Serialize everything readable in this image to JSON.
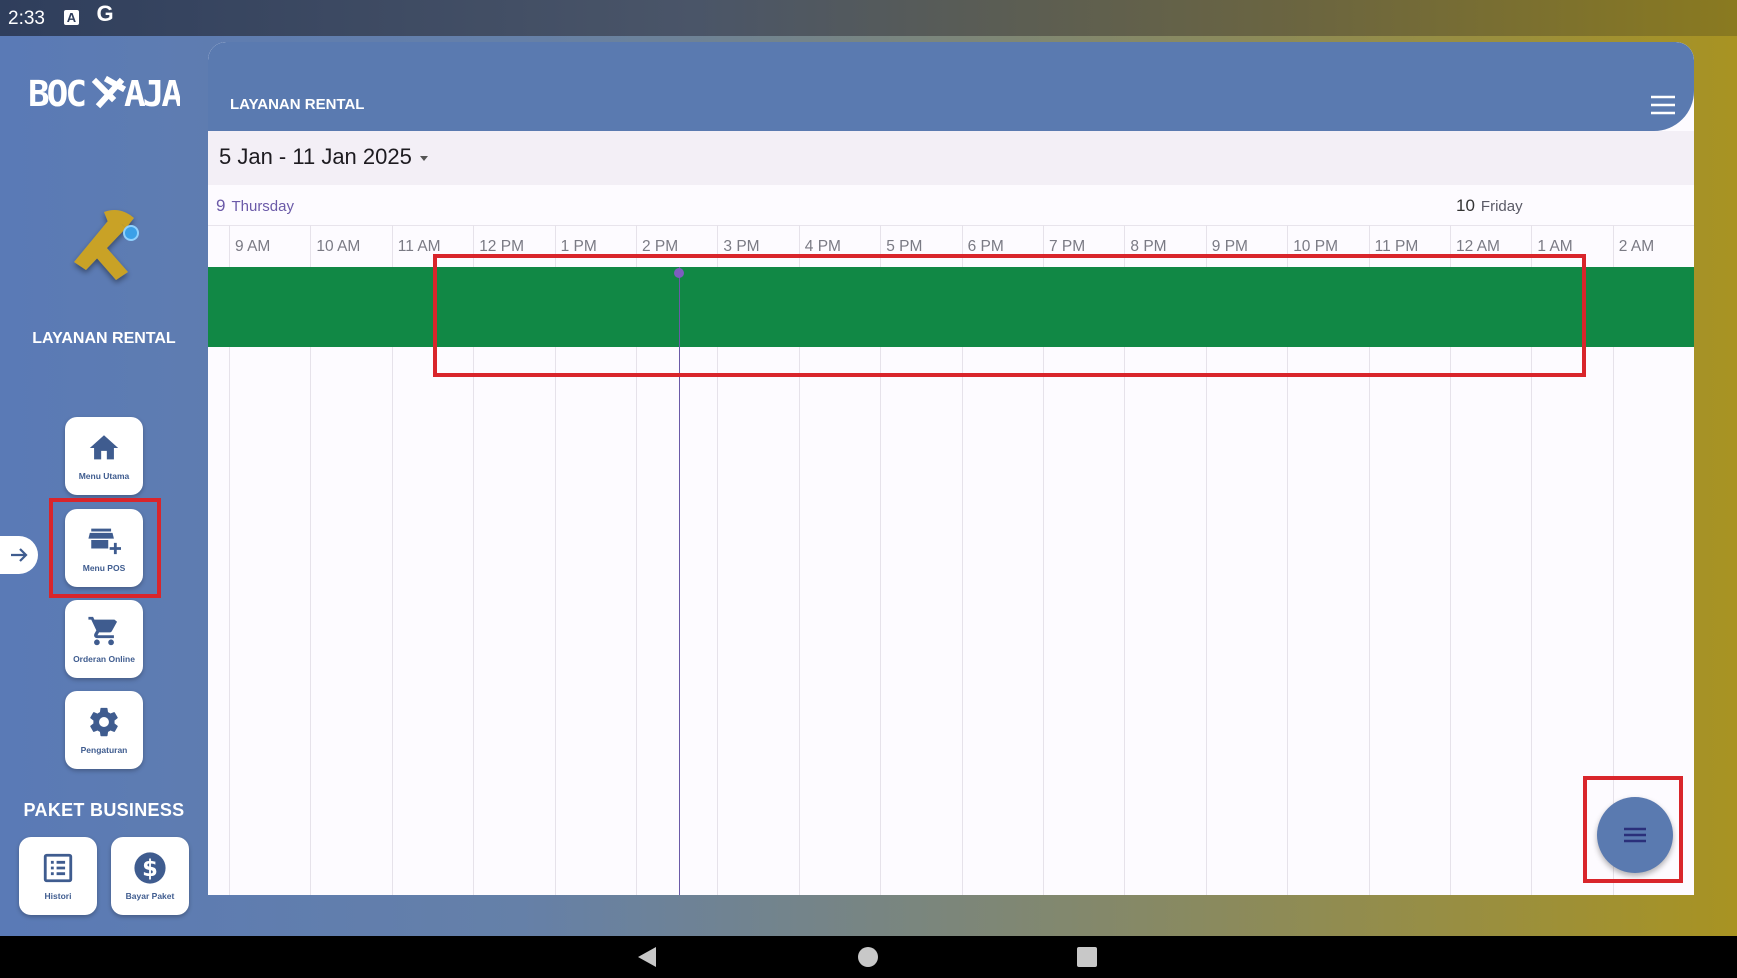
{
  "status_bar": {
    "time": "2:33",
    "icon_a": "A",
    "icon_g": "G"
  },
  "brand": {
    "logo_text": "BOC⛏AJA",
    "accent": "#5a7ab0"
  },
  "sidebar": {
    "title": "LAYANAN RENTAL",
    "tiles": [
      {
        "label": "Menu Utama",
        "icon": "home-icon"
      },
      {
        "label": "Menu POS",
        "icon": "store-add-icon"
      },
      {
        "label": "Orderan Online",
        "icon": "cart-icon"
      },
      {
        "label": "Pengaturan",
        "icon": "gear-icon"
      }
    ],
    "section_title": "PAKET BUSINESS",
    "paket_tiles": [
      {
        "label": "Histori",
        "icon": "list-icon"
      },
      {
        "label": "Bayar Paket",
        "icon": "dollar-icon"
      }
    ]
  },
  "header": {
    "title": "LAYANAN RENTAL"
  },
  "calendar": {
    "range_label": "5 Jan - 11 Jan 2025",
    "days": [
      {
        "num": "9",
        "name": "Thursday"
      },
      {
        "num": "10",
        "name": "Friday"
      }
    ],
    "hours": [
      "9 AM",
      "10 AM",
      "11 AM",
      "12 PM",
      "1 PM",
      "2 PM",
      "3 PM",
      "4 PM",
      "5 PM",
      "6 PM",
      "7 PM",
      "8 PM",
      "9 PM",
      "10 PM",
      "11 PM",
      "12 AM",
      "1 AM",
      "2 AM"
    ],
    "event_color": "#118845"
  }
}
